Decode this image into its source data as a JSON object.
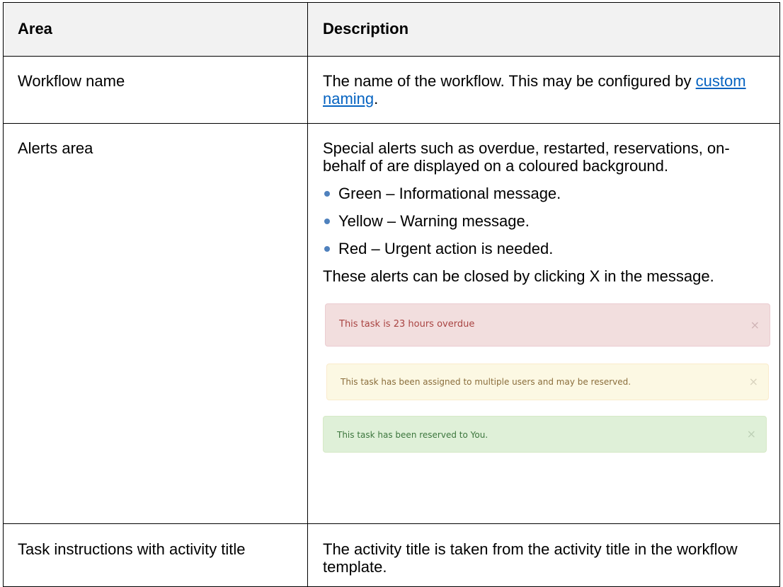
{
  "table": {
    "headers": {
      "area": "Area",
      "description": "Description"
    },
    "rows": {
      "workflow_name": {
        "area": "Workflow name",
        "description_text": "The name of the workflow. This may be configured by",
        "link_text": "custom naming",
        "description_end": "."
      },
      "alerts_area": {
        "area": "Alerts area",
        "intro": "Special alerts such as overdue, restarted, reservations, on-behalf of are displayed on a coloured background.",
        "bullets": [
          "Green – Informational message.",
          "Yellow – Warning message.",
          "Red – Urgent action is needed."
        ],
        "closing": "These alerts can be closed by clicking X in the message.",
        "examples": {
          "red": {
            "message": "This task is 23 hours overdue",
            "close": "×"
          },
          "yellow": {
            "message": "This task has been assigned to multiple users and may be reserved.",
            "close": "×"
          },
          "green": {
            "message": "This task has been reserved to You.",
            "close": "×"
          }
        }
      },
      "task_instructions": {
        "area": "Task instructions with activity title",
        "description": "The activity title is taken from the activity title in the workflow template."
      }
    }
  },
  "colors": {
    "header_bg": "#f2f2f2",
    "link": "#0563c1",
    "bullet": "#4f81bd",
    "alert_red_bg": "#f2dede",
    "alert_yellow_bg": "#fcf8e3",
    "alert_green_bg": "#dff0d8"
  }
}
